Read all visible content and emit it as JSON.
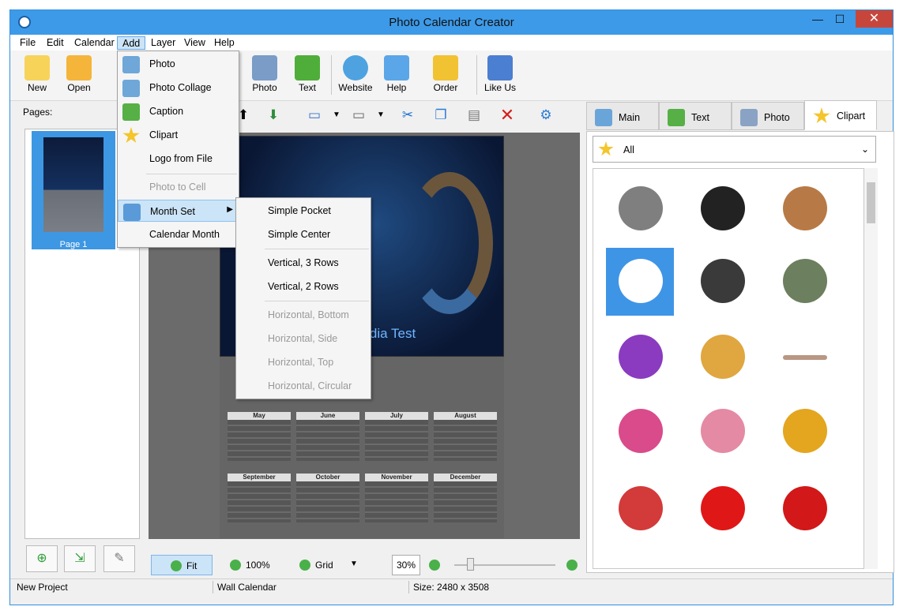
{
  "window": {
    "title": "Photo Calendar Creator",
    "minimize": "—",
    "maximize": "☐",
    "close": "✕"
  },
  "menu": [
    "File",
    "Edit",
    "Calendar",
    "Add",
    "Layer",
    "View",
    "Help"
  ],
  "toolbar": {
    "buttons": [
      {
        "label": "New",
        "icon": "new-file-icon",
        "color": "#f7d35a"
      },
      {
        "label": "Open",
        "icon": "folder-icon",
        "color": "#f5b53a"
      },
      {
        "label": "Photo",
        "icon": "camera-icon",
        "color": "#7a9cc7"
      },
      {
        "label": "Text",
        "icon": "text-a-icon",
        "color": "#4fae3a"
      },
      {
        "label": "Website",
        "icon": "globe-icon",
        "color": "#4ea2e0"
      },
      {
        "label": "Help",
        "icon": "book-icon",
        "color": "#5aa6e8"
      },
      {
        "label": "Order",
        "icon": "lock-bag-icon",
        "color": "#f1c232"
      },
      {
        "label": "Like Us",
        "icon": "thumbs-up-icon",
        "color": "#4a7fd1"
      }
    ]
  },
  "pages": {
    "label": "Pages:",
    "thumbnail": "Page 1"
  },
  "add_menu": {
    "items": [
      {
        "label": "Photo",
        "icon": "photo-add-icon",
        "disabled": false
      },
      {
        "label": "Photo Collage",
        "icon": "collage-add-icon",
        "disabled": false
      },
      {
        "label": "Caption",
        "icon": "caption-a-icon",
        "disabled": false
      },
      {
        "label": "Clipart",
        "icon": "star-icon",
        "disabled": false
      },
      {
        "label": "Logo from File",
        "icon": "",
        "disabled": false
      },
      {
        "label": "Photo to Cell",
        "icon": "",
        "disabled": true
      },
      {
        "label": "Month Set",
        "icon": "month-set-icon",
        "disabled": false
      },
      {
        "label": "Calendar Month",
        "icon": "",
        "disabled": false
      }
    ]
  },
  "month_set_menu": {
    "items": [
      {
        "label": "Simple Pocket",
        "disabled": false
      },
      {
        "label": "Simple Center",
        "disabled": false
      },
      {
        "label": "Vertical, 3 Rows",
        "disabled": false
      },
      {
        "label": "Vertical, 2 Rows",
        "disabled": false
      },
      {
        "label": "Horizontal, Bottom",
        "disabled": true
      },
      {
        "label": "Horizontal, Side",
        "disabled": true
      },
      {
        "label": "Horizontal, Top",
        "disabled": true
      },
      {
        "label": "Horizontal, Circular",
        "disabled": true
      }
    ]
  },
  "poster": {
    "title": "pedia Test",
    "months": [
      "May",
      "June",
      "July",
      "August",
      "September",
      "October",
      "November",
      "December"
    ]
  },
  "right_tabs": [
    {
      "label": "Main",
      "icon": "calendar-icon"
    },
    {
      "label": "Text",
      "icon": "text-a-icon"
    },
    {
      "label": "Photo",
      "icon": "camera-icon"
    },
    {
      "label": "Clipart",
      "icon": "star-icon"
    }
  ],
  "clipart": {
    "filter": "All",
    "items": [
      {
        "name": "zebra",
        "color": "#7f7f7f"
      },
      {
        "name": "cow",
        "color": "#222222"
      },
      {
        "name": "collie",
        "color": "#b77a46"
      },
      {
        "name": "dalmatian",
        "color": "#ffffff"
      },
      {
        "name": "husky",
        "color": "#3a3a3a"
      },
      {
        "name": "elephant",
        "color": "#6c7f5f"
      },
      {
        "name": "purple-bird",
        "color": "#8a3bbf"
      },
      {
        "name": "dog",
        "color": "#e0a640"
      },
      {
        "name": "branch",
        "color": "#b89784"
      },
      {
        "name": "pink-heart",
        "color": "#d94b8b"
      },
      {
        "name": "pink-heart-2",
        "color": "#e48aa5"
      },
      {
        "name": "bell",
        "color": "#e4a51f"
      },
      {
        "name": "balloons",
        "color": "#d33a3a"
      },
      {
        "name": "red-heart",
        "color": "#e01717"
      },
      {
        "name": "arrow-heart",
        "color": "#d21818"
      }
    ]
  },
  "bottom": {
    "fit": "Fit",
    "zoom100": "100%",
    "grid": "Grid",
    "zoom": "30%"
  },
  "status": {
    "project": "New Project",
    "type": "Wall Calendar",
    "size": "Size: 2480 x 3508"
  }
}
